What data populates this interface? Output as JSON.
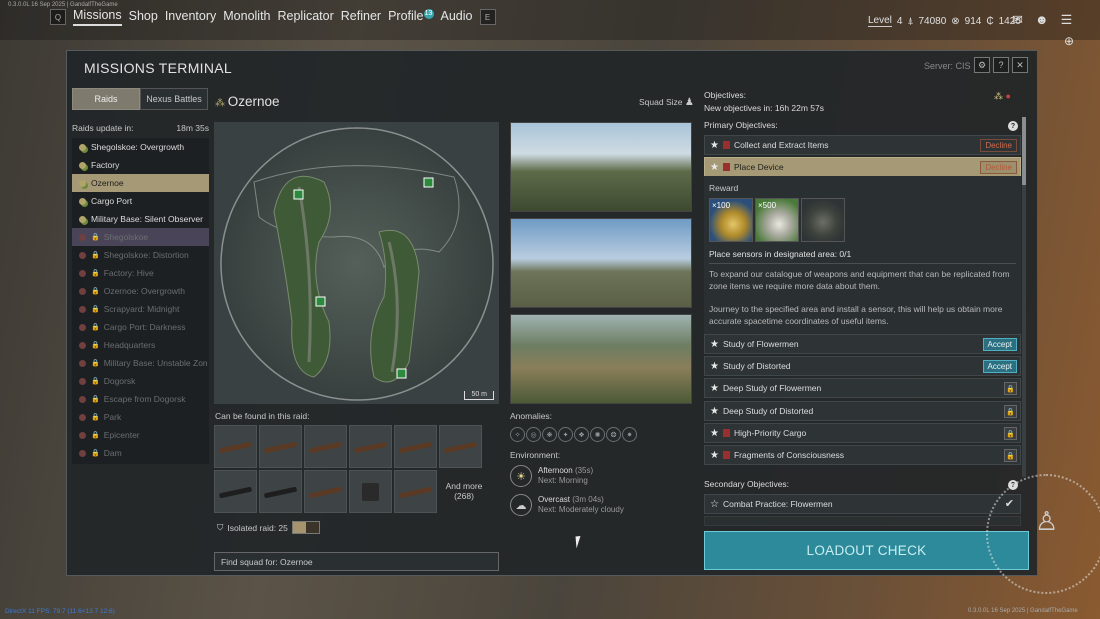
{
  "topbar": {
    "version_text": "0.3.0.0L 16 Sep 2025 | GandalfTheGame",
    "nav_key_left": "Q",
    "nav_key_right": "E",
    "nav_items": [
      {
        "label": "Missions"
      },
      {
        "label": "Shop"
      },
      {
        "label": "Inventory"
      },
      {
        "label": "Monolith"
      },
      {
        "label": "Replicator"
      },
      {
        "label": "Refiner"
      },
      {
        "label": "Profile"
      },
      {
        "label": "Audio"
      }
    ],
    "profile_badge": "13",
    "level_label": "Level",
    "level_value": "4",
    "currency1": "74080",
    "currency2": "914",
    "currency3": "1420"
  },
  "panel": {
    "title": "MISSIONS TERMINAL",
    "server": "Server: CIS",
    "tab_raids": "Raids",
    "tab_nexus": "Nexus Battles",
    "raids_update_label": "Raids update in:",
    "raids_update_time": "18m 35s",
    "raids": [
      {
        "name": "Shegolskoe: Overgrowth",
        "locked": false
      },
      {
        "name": "Factory",
        "locked": false
      },
      {
        "name": "Ozernoe",
        "locked": false
      },
      {
        "name": "Cargo Port",
        "locked": false
      },
      {
        "name": "Military Base: Silent Observer",
        "locked": false
      },
      {
        "name": "Shegolskoe",
        "locked": true
      },
      {
        "name": "Shegolskoe: Distortion",
        "locked": true
      },
      {
        "name": "Factory: Hive",
        "locked": true
      },
      {
        "name": "Ozernoe: Overgrowth",
        "locked": true
      },
      {
        "name": "Scrapyard: Midnight",
        "locked": true
      },
      {
        "name": "Cargo Port: Darkness",
        "locked": true
      },
      {
        "name": "Headquarters",
        "locked": true
      },
      {
        "name": "Military Base: Unstable Zon",
        "locked": true
      },
      {
        "name": "Dogorsk",
        "locked": true
      },
      {
        "name": "Escape from Dogorsk",
        "locked": true
      },
      {
        "name": "Park",
        "locked": true
      },
      {
        "name": "Epicenter",
        "locked": true
      },
      {
        "name": "Dam",
        "locked": true
      }
    ],
    "selected_raid": "Ozernoe",
    "map_scale": "50 m",
    "squad_size_label": "Squad Size",
    "found_label": "Can be found in this raid:",
    "and_more_label": "And more",
    "and_more_count": "(268)",
    "isolated_label": "Isolated raid: 25",
    "find_squad": "Find squad for: Ozernoe",
    "anomalies_label": "Anomalies:",
    "environment_label": "Environment:",
    "env": [
      {
        "title": "Afternoon",
        "duration": "(35s)",
        "next": "Next: Morning",
        "icon": "sun-icon"
      },
      {
        "title": "Overcast",
        "duration": "(3m 04s)",
        "next": "Next: Moderately cloudy",
        "icon": "cloud-icon"
      }
    ]
  },
  "objectives": {
    "header": "Objectives:",
    "new_in": "New objectives in: 16h 22m 57s",
    "primary_label": "Primary Objectives:",
    "primary": [
      {
        "name": "Collect and Extract Items",
        "action": "Decline",
        "red": true
      },
      {
        "name": "Place Device",
        "action": "Decline",
        "red": true
      },
      {
        "name": "Study of Flowermen",
        "action": "Accept",
        "red": false
      },
      {
        "name": "Study of Distorted",
        "action": "Accept",
        "red": false
      },
      {
        "name": "Deep Study of Flowermen",
        "action": "",
        "red": false
      },
      {
        "name": "Deep Study of Distorted",
        "action": "",
        "red": false
      },
      {
        "name": "High-Priority Cargo",
        "action": "",
        "red": true
      },
      {
        "name": "Fragments of Consciousness",
        "action": "",
        "red": true
      }
    ],
    "reward_label": "Reward",
    "reward_items": [
      {
        "qty": "×100",
        "icon": "gold-coins-icon"
      },
      {
        "qty": "×500",
        "icon": "silver-coins-icon"
      },
      {
        "qty": "",
        "icon": "helmet-icon"
      }
    ],
    "place_sensors": "Place sensors in designated area: 0/1",
    "desc1": "To expand our catalogue of weapons and equipment that can be replicated from zone items we require more data about them.",
    "desc2": "Journey to the specified area and install a sensor, this will help us obtain more accurate spacetime coordinates of useful items.",
    "secondary_label": "Secondary Objectives:",
    "secondary": [
      {
        "name": "Combat Practice: Flowermen"
      }
    ],
    "loadout_button": "LOADOUT CHECK"
  },
  "footer": {
    "fps": "DirectX 11 FPS: 79.7 (11.6<13.7 12.6)",
    "version_right": "0.3.0.0L 16 Sep 2025 | GandalfTheGame"
  },
  "colors": {
    "accent": "#2d8a9a",
    "selected": "#a69a76",
    "decline": "#d06a4a"
  }
}
